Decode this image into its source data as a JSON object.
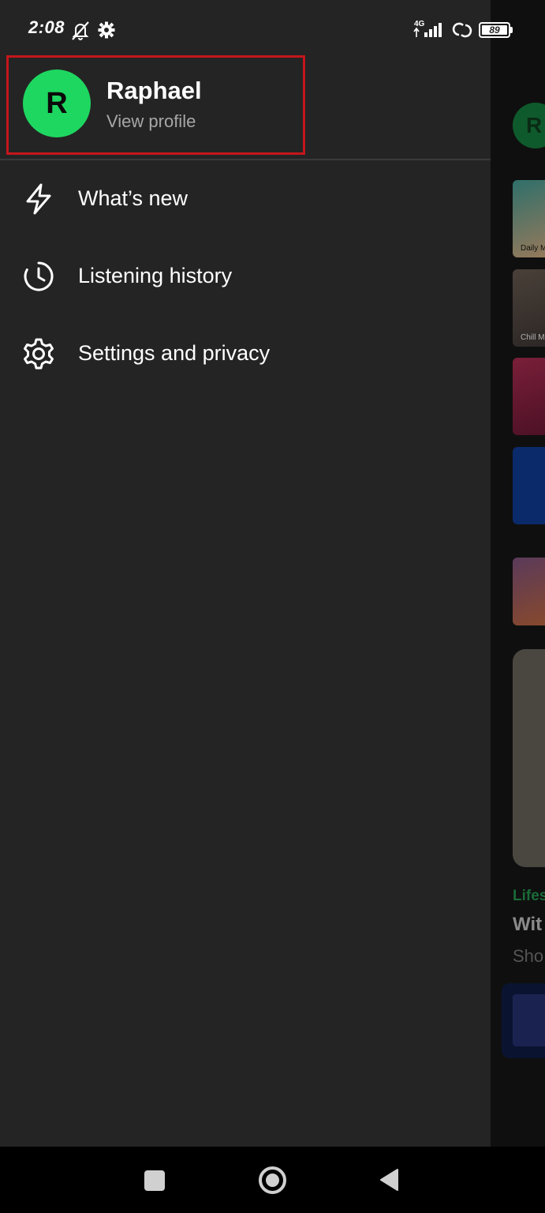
{
  "status_bar": {
    "time": "2:08",
    "network": "4G",
    "battery": "89"
  },
  "drawer": {
    "profile": {
      "initial": "R",
      "name": "Raphael",
      "subtitle": "View profile",
      "avatar_color": "#1ed760"
    },
    "menu": [
      {
        "label": "What’s new",
        "icon": "lightning-icon"
      },
      {
        "label": "Listening history",
        "icon": "history-clock-icon"
      },
      {
        "label": "Settings and privacy",
        "icon": "gear-icon"
      }
    ]
  },
  "background_app": {
    "avatar_initial": "R",
    "tile_captions": [
      "Daily M",
      "Chill M"
    ],
    "section_label": "Lifes",
    "heading": "Wit",
    "subtext": "Sho"
  },
  "nav_bar": {
    "buttons": [
      "recents-square-icon",
      "home-circle-icon",
      "back-triangle-icon"
    ]
  },
  "colors": {
    "drawer_bg": "#242424",
    "accent_green": "#1ed760",
    "highlight_red": "#c4161c",
    "secondary_text": "#a7a7a7"
  }
}
